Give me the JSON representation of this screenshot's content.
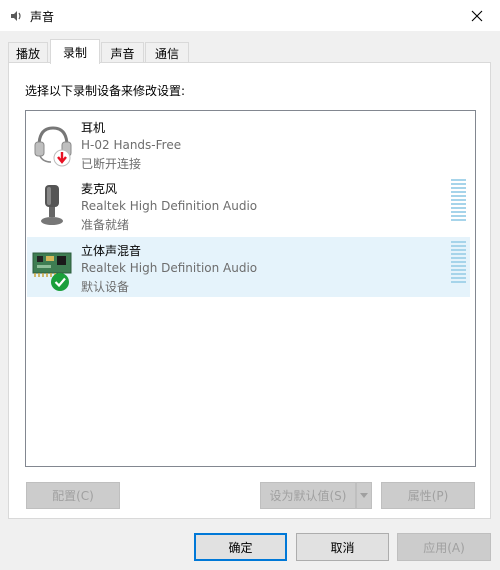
{
  "window": {
    "title": "声音"
  },
  "tabs": [
    {
      "label": "播放",
      "active": false
    },
    {
      "label": "录制",
      "active": true
    },
    {
      "label": "声音",
      "active": false
    },
    {
      "label": "通信",
      "active": false
    }
  ],
  "recording": {
    "instruction": "选择以下录制设备来修改设置:",
    "devices": [
      {
        "name": "耳机",
        "description": "H-02 Hands-Free",
        "status": "已断开连接",
        "icon": "headset-disconnected-icon",
        "selected": false
      },
      {
        "name": "麦克风",
        "description": "Realtek High Definition Audio",
        "status": "准备就绪",
        "icon": "microphone-icon",
        "selected": false
      },
      {
        "name": "立体声混音",
        "description": "Realtek High Definition Audio",
        "status": "默认设备",
        "icon": "sound-card-default-icon",
        "selected": true
      }
    ],
    "buttons": {
      "configure": "配置(C)",
      "set_default": "设为默认值(S)",
      "properties": "属性(P)"
    }
  },
  "footer": {
    "ok": "确定",
    "cancel": "取消",
    "apply": "应用(A)"
  },
  "colors": {
    "accent": "#0078d7",
    "selected_row": "#e5f3fb",
    "meter": "#a6d4ea",
    "default_check": "#1a9f3b",
    "disconnected_arrow": "#e81123"
  }
}
